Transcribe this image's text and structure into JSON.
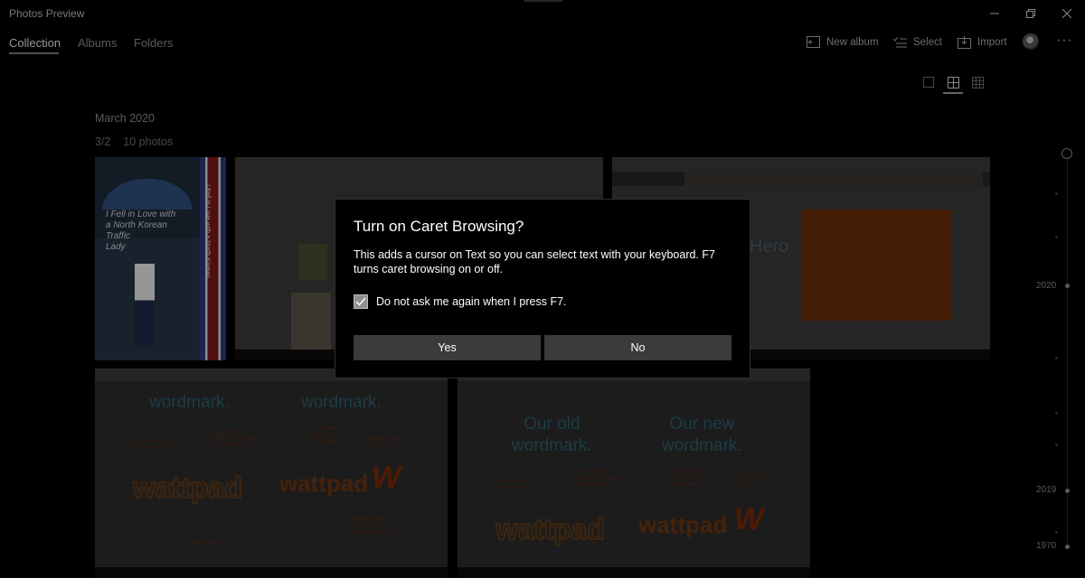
{
  "app": {
    "title": "Photos Preview"
  },
  "window_controls": {
    "minimize_icon": "minimize-icon",
    "maximize_icon": "restore-icon",
    "close_icon": "close-icon"
  },
  "nav": {
    "tabs": [
      {
        "label": "Collection",
        "active": true
      },
      {
        "label": "Albums"
      },
      {
        "label": "Folders"
      }
    ]
  },
  "commands": {
    "new_album": "New album",
    "select": "Select",
    "import": "Import",
    "more": "···"
  },
  "view_toggles": [
    "large-tiles-icon",
    "medium-tiles-icon",
    "small-tiles-icon"
  ],
  "collection": {
    "month_header": "March 2020",
    "date": "3/2",
    "count": "10 photos"
  },
  "photos": {
    "book": {
      "title_lines": "I Fell in Love with\na North Korean\nTraffic\nLady",
      "side_text": "I Fell in Love with a North Korean"
    },
    "slide_hero": {
      "word": "Hero"
    },
    "wordmark_1": {
      "left_heading": "wordmark.",
      "right_heading": "wordmark.",
      "note_1": "This is actually\nan upside-down M",
      "note_2": "A free web font\nWattpad co-founder\nIvan Yuen found",
      "note_3": "Connected ’s\nreference our\ncommunity",
      "note_4": "Provides sense\nof motion",
      "note_5": "Customized serifs\ncreate connection\nthroughout wordmark",
      "note_6": "Dated, static",
      "wattpad_old": "wattpad",
      "wattpad_new": "wattpad",
      "w_logo": "W"
    },
    "wordmark_2": {
      "left_heading": "Our old\nwordmark.",
      "right_heading": "Our new\nwordmark.",
      "note_1": "This is actually\nan upside-down M",
      "note_2": "A free web font\nWattpad co-founder\nIvan Yuen found",
      "note_3": "Connected r's\nreference our\ncommunity",
      "note_4": "Provides sense\nof motion",
      "wattpad_old": "wattpad",
      "wattpad_new": "wattpad",
      "w_logo": "W"
    }
  },
  "timeline": {
    "years": [
      "2020",
      "2019",
      "1970"
    ]
  },
  "dialog": {
    "title": "Turn on Caret Browsing?",
    "body": "This adds a cursor on Text so you can select text with your keyboard. F7 turns caret browsing on or off.",
    "checkbox_label": "Do not ask me again when I press F7.",
    "checkbox_checked": true,
    "yes_label": "Yes",
    "no_label": "No"
  },
  "colors": {
    "background": "#000000",
    "dialog_button": "#3b3b3b",
    "accent_orange": "#6b2c0a"
  }
}
